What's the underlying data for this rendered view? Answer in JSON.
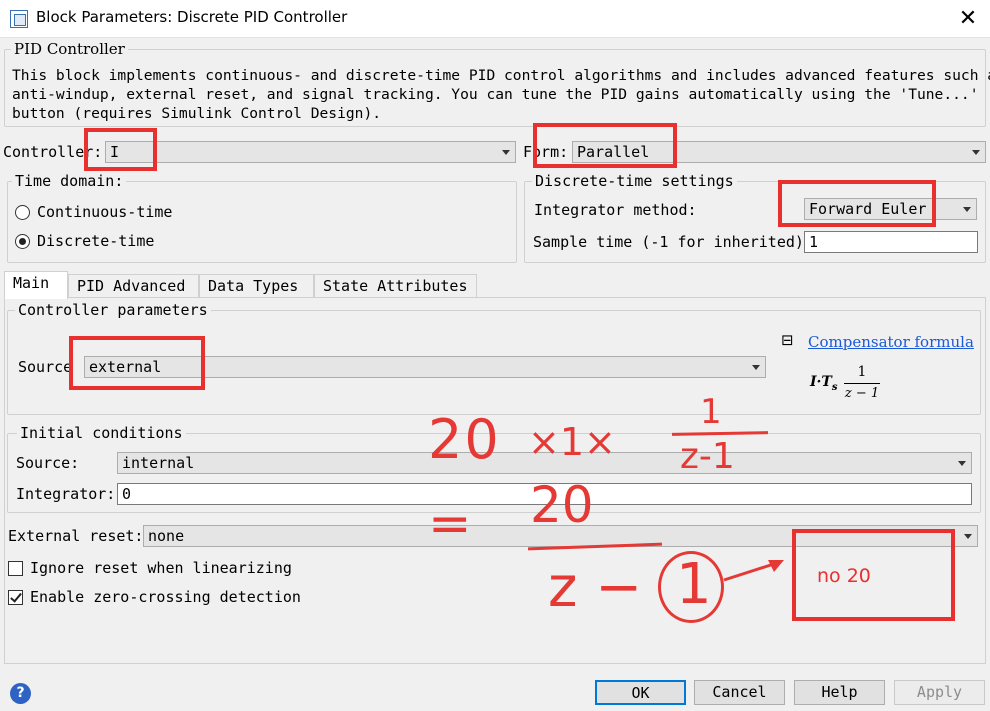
{
  "window": {
    "title": "Block Parameters: Discrete PID Controller",
    "close_glyph": "✕"
  },
  "block": {
    "group_title": "PID Controller",
    "description_line1": "This block implements continuous- and discrete-time PID control algorithms and includes advanced features such as",
    "description_line2": "anti-windup, external reset, and signal tracking. You can tune the PID gains automatically using the 'Tune...'",
    "description_line3": "button (requires Simulink Control Design)."
  },
  "controller": {
    "label": "Controller:",
    "value": "I"
  },
  "form": {
    "label": "Form:",
    "value": "Parallel"
  },
  "time_domain": {
    "title": "Time domain:",
    "options": [
      {
        "label": "Continuous-time",
        "selected": false
      },
      {
        "label": "Discrete-time",
        "selected": true
      }
    ]
  },
  "discrete_settings": {
    "title": "Discrete-time settings",
    "integrator_label": "Integrator method:",
    "integrator_value": "Forward Euler",
    "sample_label": "Sample time (-1 for inherited):",
    "sample_value": "1"
  },
  "tabs": [
    {
      "label": "Main",
      "active": true
    },
    {
      "label": "PID Advanced",
      "active": false
    },
    {
      "label": "Data Types",
      "active": false
    },
    {
      "label": "State Attributes",
      "active": false
    }
  ],
  "controller_params": {
    "title": "Controller parameters",
    "source_label": "Source",
    "source_value": "external",
    "compensator_toggle": "⊟",
    "compensator_link": "Compensator formula",
    "formula_gain": "I·T",
    "formula_sub": "s",
    "formula_num": "1",
    "formula_den": "z − 1"
  },
  "initial_conditions": {
    "title": "Initial conditions",
    "source_label": "Source:",
    "source_value": "internal",
    "integrator_label": "Integrator:",
    "integrator_value": "0"
  },
  "external_reset": {
    "label": "External reset:",
    "value": "none"
  },
  "checkboxes": [
    {
      "label": "Ignore reset when linearizing",
      "checked": false
    },
    {
      "label": "Enable zero-crossing detection",
      "checked": true
    }
  ],
  "buttons": {
    "help_icon": "?",
    "ok": "OK",
    "cancel": "Cancel",
    "help": "Help",
    "apply": "Apply"
  },
  "annotations": {
    "line1_a": "20",
    "line1_times": "×1×",
    "line1_num": "1",
    "line1_den": "z-1",
    "line2_eq": "=",
    "line2_num": "20",
    "line2_den_z": "z −",
    "line2_den_one": "1",
    "note": "no 20",
    "color": "#e8302f"
  }
}
